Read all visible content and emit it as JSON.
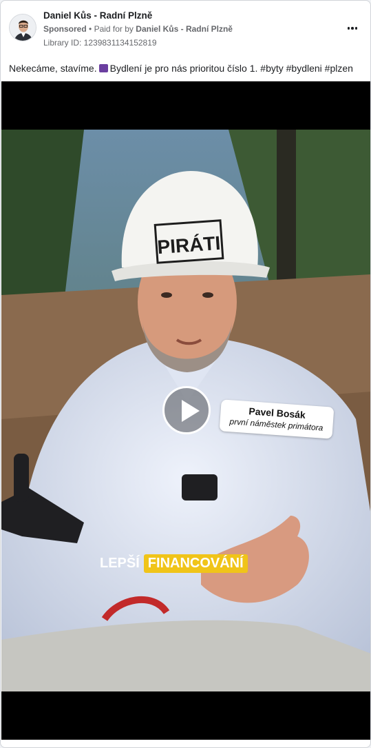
{
  "post": {
    "page_name": "Daniel Kůs - Radní Plzně",
    "sponsored_label": "Sponsored",
    "separator": "•",
    "paid_for_prefix": "Paid for by",
    "paid_for_by": "Daniel Kůs - Radní Plzně",
    "library_id": "Library ID: 1239831134152819",
    "caption_part1": "Nekecáme, stavíme.",
    "caption_part2": "Bydlení je pro nás prioritou číslo 1. #byty #bydleni #plzen",
    "more_icon": "more-horizontal-icon"
  },
  "video": {
    "helmet_text": "PIRÁTI",
    "name_tag_name": "Pavel Bosák",
    "name_tag_role": "první náměstek primátora",
    "subtitle_white": "LEPŠÍ",
    "subtitle_highlight": "FINANCOVÁNÍ",
    "play_icon": "play-icon"
  },
  "colors": {
    "text_primary": "#1c1e21",
    "text_secondary": "#65676b",
    "subtitle_highlight": "#f0c419"
  }
}
